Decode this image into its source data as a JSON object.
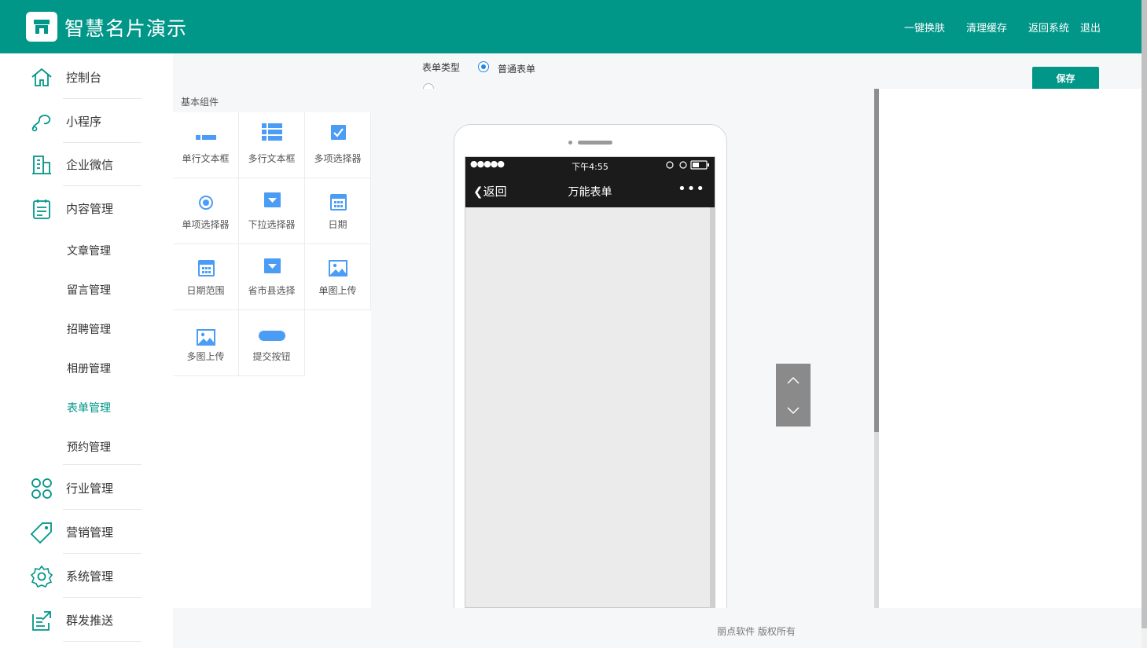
{
  "header": {
    "title": "智慧名片演示",
    "links": [
      "一键换肤",
      "清理缓存",
      "返回系统",
      "退出"
    ]
  },
  "sidebar": {
    "items": [
      {
        "label": "控制台",
        "icon": "home-icon"
      },
      {
        "label": "小程序",
        "icon": "miniprogram-icon"
      },
      {
        "label": "企业微信",
        "icon": "building-icon"
      },
      {
        "label": "内容管理",
        "icon": "clipboard-icon"
      }
    ],
    "sub_items": [
      "文章管理",
      "留言管理",
      "招聘管理",
      "相册管理",
      "表单管理",
      "预约管理"
    ],
    "active_sub": "表单管理",
    "bottom_items": [
      {
        "label": "行业管理",
        "icon": "clover-icon"
      },
      {
        "label": "营销管理",
        "icon": "tag-icon"
      },
      {
        "label": "系统管理",
        "icon": "gear-icon"
      },
      {
        "label": "群发推送",
        "icon": "share-icon"
      }
    ]
  },
  "form_type": {
    "label": "表单类型",
    "options": [
      "普通表单"
    ],
    "selected": "普通表单"
  },
  "save_button": "保存",
  "components": {
    "heading": "基本组件",
    "items": [
      {
        "label": "单行文本框",
        "icon": "single-line-text-icon"
      },
      {
        "label": "多行文本框",
        "icon": "multi-line-text-icon"
      },
      {
        "label": "多项选择器",
        "icon": "checkbox-icon"
      },
      {
        "label": "单项选择器",
        "icon": "radio-icon"
      },
      {
        "label": "下拉选择器",
        "icon": "dropdown-icon"
      },
      {
        "label": "日期",
        "icon": "calendar-icon"
      },
      {
        "label": "日期范围",
        "icon": "calendar-range-icon"
      },
      {
        "label": "省市县选择",
        "icon": "region-dropdown-icon"
      },
      {
        "label": "单图上传",
        "icon": "image-icon"
      },
      {
        "label": "多图上传",
        "icon": "images-icon"
      },
      {
        "label": "提交按钮",
        "icon": "submit-button-icon"
      }
    ]
  },
  "phone": {
    "signal": "●●●●●",
    "time": "下午4:55",
    "back": "返回",
    "title": "万能表单",
    "more": "•••"
  },
  "footer": "丽点软件 版权所有",
  "colors": {
    "brand": "#009688",
    "accent_blue": "#1e88e5",
    "icon_blue": "#4a9cf5"
  }
}
